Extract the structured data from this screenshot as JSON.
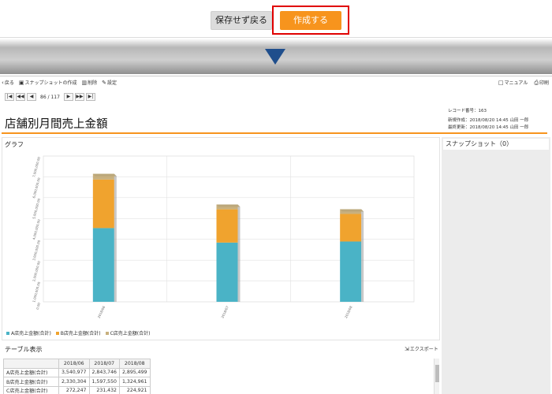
{
  "top": {
    "save_no_label": "保存せず戻る",
    "create_label": "作成する"
  },
  "toolbar": {
    "back": "戻る",
    "create_snapshot": "スナップショットの作成",
    "delete": "削除",
    "settings": "設定",
    "manual": "マニュアル",
    "print": "印刷"
  },
  "pager": {
    "first": "|◀",
    "prev10": "◀◀",
    "prev": "◀",
    "count": "86 / 117",
    "next": "▶",
    "next10": "▶▶",
    "last": "▶|"
  },
  "meta": {
    "record_no": "レコード番号：163",
    "created": "新規作成：2018/08/20 14:45 山田 一郎",
    "updated": "最終更新：2018/08/20 14:45 山田 一郎"
  },
  "page_title": "店舗別月間売上金額",
  "graph_panel_title": "グラフ",
  "snapshot_title": "スナップショット（0）",
  "table_panel_title": "テーブル表示",
  "export_label": "エクスポート",
  "colors": {
    "a": "#4ab3c6",
    "b": "#f0a32e",
    "c": "#c8b07e",
    "accent": "#f7941d"
  },
  "chart_data": {
    "type": "bar",
    "stacked": true,
    "categories": [
      "2018/06",
      "2018/07",
      "2018/08"
    ],
    "series": [
      {
        "name": "A店売上金額(合計)",
        "values": [
          3540977,
          2843746,
          2895499
        ]
      },
      {
        "name": "B店売上金額(合計)",
        "values": [
          2330304,
          1597550,
          1324961
        ]
      },
      {
        "name": "C店売上金額(合計)",
        "values": [
          272247,
          231432,
          224921
        ]
      }
    ],
    "ylim": [
      0,
      7000000
    ],
    "yticks": [
      "0.00",
      "1,000,000.00",
      "2,000,000.00",
      "3,000,000.00",
      "4,000,000.00",
      "5,000,000.00",
      "6,000,000.00",
      "7,000,000.00"
    ],
    "legend": "bottom-left",
    "grid": true
  },
  "table": {
    "headers": [
      "",
      "2018/06",
      "2018/07",
      "2018/08"
    ],
    "rows": [
      [
        "A店売上金額(合計)",
        "3,540,977",
        "2,843,746",
        "2,895,499"
      ],
      [
        "B店売上金額(合計)",
        "2,330,304",
        "1,597,550",
        "1,324,961"
      ],
      [
        "C店売上金額(合計)",
        "272,247",
        "231,432",
        "224,921"
      ]
    ]
  }
}
